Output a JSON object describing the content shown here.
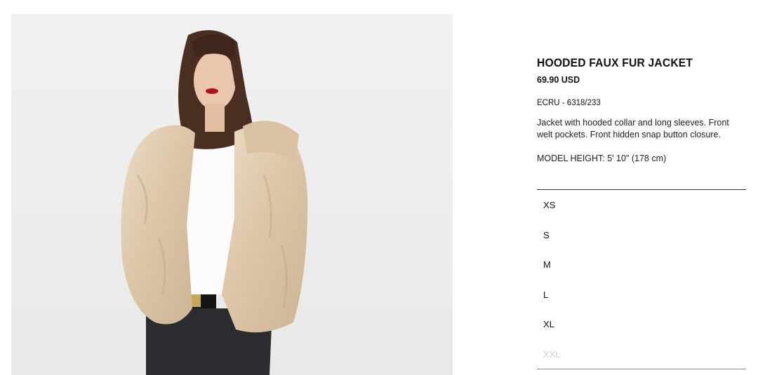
{
  "product": {
    "title": "HOODED FAUX FUR JACKET",
    "price": "69.90 USD",
    "reference": "ECRU - 6318/233",
    "description": "Jacket with hooded collar and long sleeves. Front welt pockets. Front hidden snap button closure.",
    "model_height": "MODEL HEIGHT: 5' 10\" (178 cm)"
  },
  "sizes": [
    {
      "label": "XS",
      "available": true
    },
    {
      "label": "S",
      "available": true
    },
    {
      "label": "M",
      "available": true
    },
    {
      "label": "L",
      "available": true
    },
    {
      "label": "XL",
      "available": true
    },
    {
      "label": "XXL",
      "available": false
    }
  ],
  "colors": {
    "photo_background": "#eeeeee",
    "jacket": "#e3cfb6",
    "unavailable_text": "#cfcfcf"
  }
}
